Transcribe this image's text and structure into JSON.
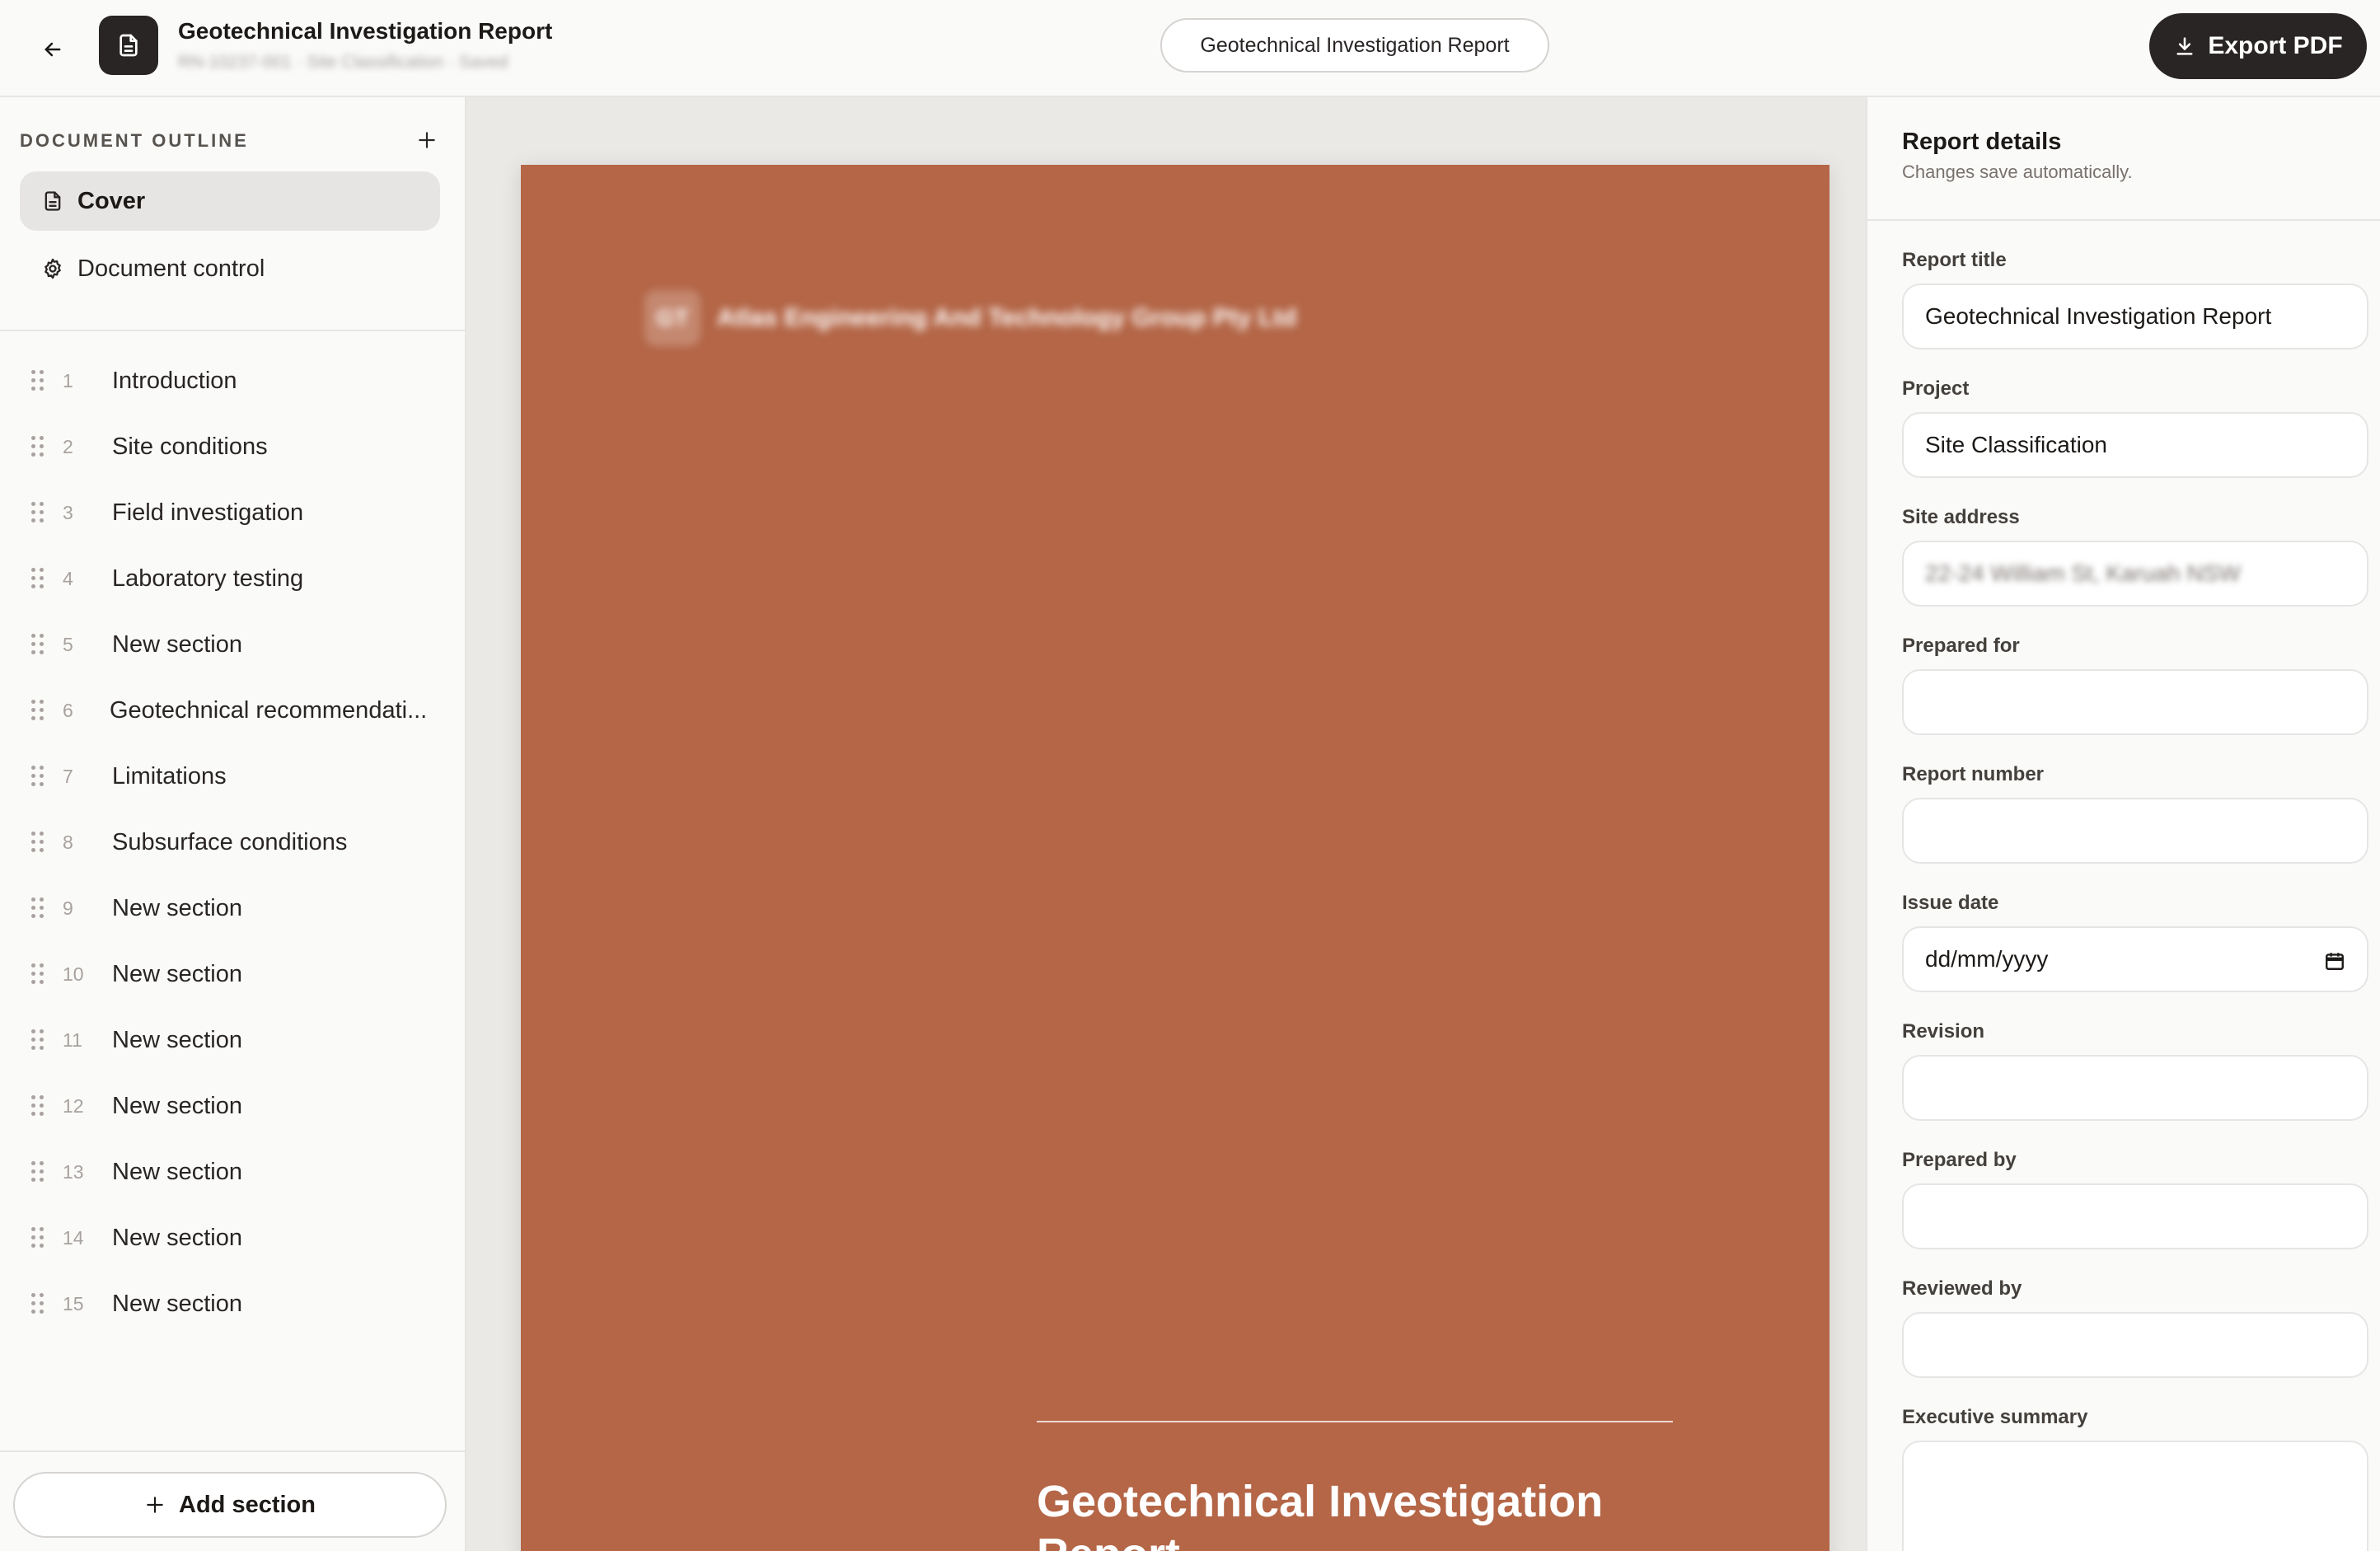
{
  "header": {
    "title": "Geotechnical Investigation Report",
    "subtitle": "RN-10237-001 · Site Classification · Saved",
    "center_pill": "Geotechnical Investigation Report",
    "export_label": "Export PDF",
    "back_icon": "arrow-left-icon",
    "doc_icon": "document-icon",
    "download_icon": "download-icon"
  },
  "sidebar": {
    "outline_label": "DOCUMENT OUTLINE",
    "cover_label": "Cover",
    "doc_control_label": "Document control",
    "sections": [
      {
        "num": "1",
        "title": "Introduction"
      },
      {
        "num": "2",
        "title": "Site conditions"
      },
      {
        "num": "3",
        "title": "Field investigation"
      },
      {
        "num": "4",
        "title": "Laboratory testing"
      },
      {
        "num": "5",
        "title": "New section"
      },
      {
        "num": "6",
        "title": "Geotechnical recommendati..."
      },
      {
        "num": "7",
        "title": "Limitations"
      },
      {
        "num": "8",
        "title": "Subsurface conditions"
      },
      {
        "num": "9",
        "title": "New section"
      },
      {
        "num": "10",
        "title": "New section"
      },
      {
        "num": "11",
        "title": "New section"
      },
      {
        "num": "12",
        "title": "New section"
      },
      {
        "num": "13",
        "title": "New section"
      },
      {
        "num": "14",
        "title": "New section"
      },
      {
        "num": "15",
        "title": "New section"
      }
    ],
    "add_section_label": "Add section"
  },
  "page": {
    "logo_initials": "GT",
    "company": "Atlas Engineering And Technology Group Pty Ltd",
    "title": "Geotechnical Investigation Report",
    "background": "#b46647"
  },
  "panel": {
    "title": "Report details",
    "subtitle": "Changes save automatically.",
    "fields": {
      "report_title": {
        "label": "Report title",
        "value": "Geotechnical Investigation Report"
      },
      "project": {
        "label": "Project",
        "value": "Site Classification"
      },
      "site_address": {
        "label": "Site address",
        "value": "22-24 William St, Karuah NSW"
      },
      "prepared_for": {
        "label": "Prepared for",
        "value": ""
      },
      "report_number": {
        "label": "Report number",
        "value": ""
      },
      "issue_date": {
        "label": "Issue date",
        "value": "dd/mm/yyyy"
      },
      "revision": {
        "label": "Revision",
        "value": ""
      },
      "prepared_by": {
        "label": "Prepared by",
        "value": ""
      },
      "reviewed_by": {
        "label": "Reviewed by",
        "value": ""
      },
      "executive_summary": {
        "label": "Executive summary",
        "value": ""
      }
    }
  },
  "colors": {
    "accent_dark": "#292524",
    "cover_color": "#b46647"
  }
}
